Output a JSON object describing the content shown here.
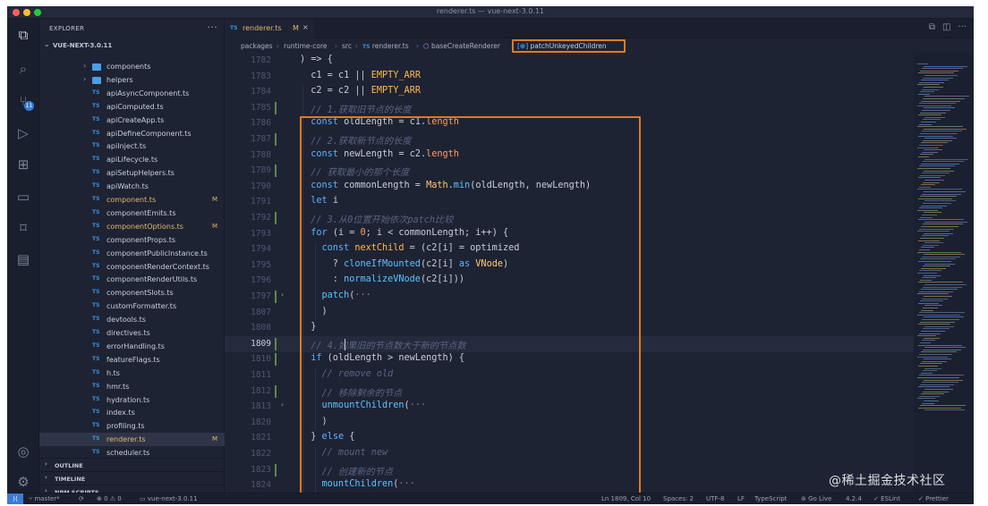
{
  "window": {
    "title": "renderer.ts — vue-next-3.0.11"
  },
  "activity_bar": {
    "icons": [
      "files-icon",
      "search-icon",
      "source-control-icon",
      "run-debug-icon",
      "extensions-icon",
      "remote-explorer-icon",
      "bookmarks-icon",
      "folder-icon",
      "account-icon",
      "settings-gear-icon"
    ],
    "scm_badge": "11"
  },
  "sidebar": {
    "title": "EXPLORER",
    "more": "···",
    "project": "VUE-NEXT-3.0.11",
    "folders": [
      "components",
      "helpers"
    ],
    "files": [
      {
        "name": "apiAsyncComponent.ts",
        "flag": ""
      },
      {
        "name": "apiComputed.ts",
        "flag": ""
      },
      {
        "name": "apiCreateApp.ts",
        "flag": ""
      },
      {
        "name": "apiDefineComponent.ts",
        "flag": ""
      },
      {
        "name": "apiInject.ts",
        "flag": ""
      },
      {
        "name": "apiLifecycle.ts",
        "flag": ""
      },
      {
        "name": "apiSetupHelpers.ts",
        "flag": ""
      },
      {
        "name": "apiWatch.ts",
        "flag": ""
      },
      {
        "name": "component.ts",
        "flag": "M"
      },
      {
        "name": "componentEmits.ts",
        "flag": ""
      },
      {
        "name": "componentOptions.ts",
        "flag": "M"
      },
      {
        "name": "componentProps.ts",
        "flag": ""
      },
      {
        "name": "componentPublicInstance.ts",
        "flag": ""
      },
      {
        "name": "componentRenderContext.ts",
        "flag": ""
      },
      {
        "name": "componentRenderUtils.ts",
        "flag": ""
      },
      {
        "name": "componentSlots.ts",
        "flag": ""
      },
      {
        "name": "customFormatter.ts",
        "flag": ""
      },
      {
        "name": "devtools.ts",
        "flag": ""
      },
      {
        "name": "directives.ts",
        "flag": ""
      },
      {
        "name": "errorHandling.ts",
        "flag": ""
      },
      {
        "name": "featureFlags.ts",
        "flag": ""
      },
      {
        "name": "h.ts",
        "flag": ""
      },
      {
        "name": "hmr.ts",
        "flag": ""
      },
      {
        "name": "hydration.ts",
        "flag": ""
      },
      {
        "name": "index.ts",
        "flag": ""
      },
      {
        "name": "profiling.ts",
        "flag": ""
      },
      {
        "name": "renderer.ts",
        "flag": "M"
      },
      {
        "name": "scheduler.ts",
        "flag": ""
      }
    ],
    "file_icon_label": "TS",
    "sections": [
      "OUTLINE",
      "TIMELINE",
      "NPM SCRIPTS"
    ]
  },
  "tabs": [
    {
      "label": "renderer.ts",
      "mark": "M",
      "icon": "TS",
      "close": "×"
    }
  ],
  "tab_actions": [
    "⧉",
    "◫",
    "···"
  ],
  "breadcrumb": {
    "items": [
      "packages",
      "runtime-core",
      "src",
      "renderer.ts",
      "baseCreateRenderer",
      "patchUnkeyedChildren"
    ],
    "separator": "›"
  },
  "code_lines": [
    {
      "n": "1782",
      "segs": [
        [
          "p",
          ") => {"
        ]
      ]
    },
    {
      "n": "1783",
      "segs": [
        [
          "v",
          "  c1 = c1 "
        ],
        [
          "p",
          "||"
        ],
        [
          "c",
          " EMPTY_ARR"
        ]
      ]
    },
    {
      "n": "1784",
      "segs": [
        [
          "v",
          "  c2 = c2 "
        ],
        [
          "p",
          "||"
        ],
        [
          "c",
          " EMPTY_ARR"
        ]
      ]
    },
    {
      "n": "1785",
      "segs": [
        [
          "m",
          "  // 1.获取旧节点的长度"
        ]
      ]
    },
    {
      "n": "1786",
      "segs": [
        [
          "k",
          "  const "
        ],
        [
          "v",
          "oldLength = c1."
        ],
        [
          "r",
          "length"
        ]
      ]
    },
    {
      "n": "1787",
      "segs": [
        [
          "m",
          "  // 2.获取新节点的长度"
        ]
      ]
    },
    {
      "n": "1788",
      "segs": [
        [
          "k",
          "  const "
        ],
        [
          "v",
          "newLength = c2."
        ],
        [
          "r",
          "length"
        ]
      ]
    },
    {
      "n": "1789",
      "segs": [
        [
          "m",
          "  // 获取最小的那个长度"
        ]
      ]
    },
    {
      "n": "1790",
      "segs": [
        [
          "k",
          "  const "
        ],
        [
          "v",
          "commonLength = "
        ],
        [
          "t",
          "Math"
        ],
        [
          "v",
          "."
        ],
        [
          "f",
          "min"
        ],
        [
          "v",
          "(oldLength, newLength)"
        ]
      ]
    },
    {
      "n": "1791",
      "segs": [
        [
          "k",
          "  let "
        ],
        [
          "v",
          "i"
        ]
      ]
    },
    {
      "n": "1792",
      "segs": [
        [
          "m",
          "  // 3.从0位置开始依次patch比较"
        ]
      ]
    },
    {
      "n": "1793",
      "segs": [
        [
          "k",
          "  for "
        ],
        [
          "v",
          "(i = "
        ],
        [
          "r",
          "0"
        ],
        [
          "v",
          "; i < commonLength; i++) {"
        ]
      ]
    },
    {
      "n": "1794",
      "segs": [
        [
          "k",
          "    const "
        ],
        [
          "c",
          "nextChild"
        ],
        [
          "v",
          " = (c2[i] = optimized"
        ]
      ]
    },
    {
      "n": "1795",
      "segs": [
        [
          "v",
          "      ? "
        ],
        [
          "f",
          "cloneIfMounted"
        ],
        [
          "v",
          "(c2[i] "
        ],
        [
          "k",
          "as "
        ],
        [
          "t",
          "VNode"
        ],
        [
          "v",
          ")"
        ]
      ]
    },
    {
      "n": "1796",
      "segs": [
        [
          "v",
          "      : "
        ],
        [
          "f",
          "normalizeVNode"
        ],
        [
          "v",
          "(c2[i]))"
        ]
      ]
    },
    {
      "n": "1797",
      "segs": [
        [
          "f",
          "    patch"
        ],
        [
          "v",
          "("
        ],
        [
          "z",
          "···"
        ]
      ]
    },
    {
      "n": "1807",
      "segs": [
        [
          "v",
          "    )"
        ]
      ]
    },
    {
      "n": "1808",
      "segs": [
        [
          "v",
          "  }"
        ]
      ]
    },
    {
      "n": "1809",
      "segs": [
        [
          "m",
          "  // 4.如果旧的节点数大于新的节点数"
        ]
      ]
    },
    {
      "n": "1810",
      "segs": [
        [
          "k",
          "  if "
        ],
        [
          "v",
          "(oldLength > newLength) {"
        ]
      ]
    },
    {
      "n": "1811",
      "segs": [
        [
          "m",
          "    // remove old"
        ]
      ]
    },
    {
      "n": "1812",
      "segs": [
        [
          "m",
          "    // 移除剩余的节点"
        ]
      ]
    },
    {
      "n": "1813",
      "segs": [
        [
          "f",
          "    unmountChildren"
        ],
        [
          "v",
          "("
        ],
        [
          "z",
          "···"
        ]
      ]
    },
    {
      "n": "1820",
      "segs": [
        [
          "v",
          "    )"
        ]
      ]
    },
    {
      "n": "1821",
      "segs": [
        [
          "v",
          "  } "
        ],
        [
          "k",
          "else "
        ],
        [
          "v",
          "{"
        ]
      ]
    },
    {
      "n": "1822",
      "segs": [
        [
          "m",
          "    // mount new"
        ]
      ]
    },
    {
      "n": "1823",
      "segs": [
        [
          "m",
          "    // 创建新的节点"
        ]
      ]
    },
    {
      "n": "1824",
      "segs": [
        [
          "f",
          "    mountChildren"
        ],
        [
          "v",
          "("
        ],
        [
          "z",
          "···"
        ]
      ]
    }
  ],
  "statusbar": {
    "remote": "⟩⟨",
    "branch": "master*",
    "sync": "⟳",
    "problems": "⊗ 0 ⚠ 0",
    "workspace": "vue-next-3.0.11",
    "position": "Ln 1809, Col 10",
    "spaces": "Spaces: 2",
    "encoding": "UTF-8",
    "eol": "LF",
    "language": "TypeScript",
    "golive": "Go Live",
    "version": "4.2.4",
    "eslint": "✓ ESLint",
    "prettier": "✓ Prettier"
  },
  "watermark": "@稀土掘金技术社区",
  "colors": {
    "highlight_box": "#e07a1f",
    "accent": "#3a7bd5",
    "modified": "#e2b86b"
  }
}
